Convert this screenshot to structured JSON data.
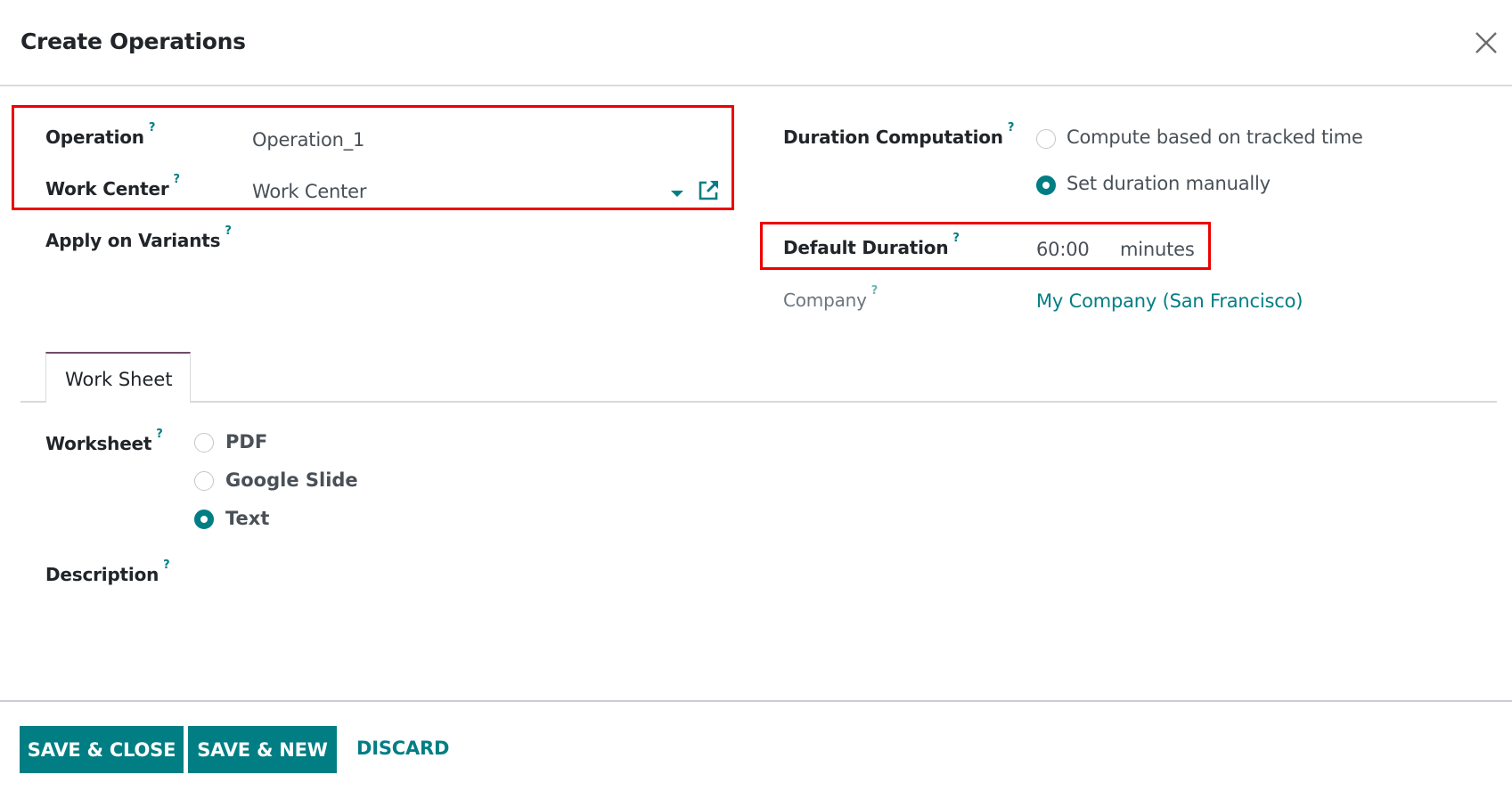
{
  "dialog": {
    "title": "Create Operations",
    "close_icon": "close-icon"
  },
  "fields": {
    "operation": {
      "label": "Operation",
      "help": "?",
      "value": "Operation_1"
    },
    "work_center": {
      "label": "Work Center",
      "help": "?",
      "value": "Work Center",
      "dropdown_icon": "caret-down-icon",
      "external_link_icon": "external-link-icon"
    },
    "apply_on_variants": {
      "label": "Apply on Variants",
      "help": "?",
      "value": ""
    },
    "duration_computation": {
      "label": "Duration Computation",
      "help": "?",
      "options": [
        {
          "label": "Compute based on tracked time",
          "checked": false
        },
        {
          "label": "Set duration manually",
          "checked": true
        }
      ]
    },
    "default_duration": {
      "label": "Default Duration",
      "help": "?",
      "value": "60:00",
      "unit": "minutes"
    },
    "company": {
      "label": "Company",
      "help": "?",
      "value": "My Company (San Francisco)"
    }
  },
  "tabs": [
    {
      "label": "Work Sheet",
      "active": true
    }
  ],
  "worksheet": {
    "label": "Worksheet",
    "help": "?",
    "options": [
      {
        "label": "PDF",
        "checked": false
      },
      {
        "label": "Google Slide",
        "checked": false
      },
      {
        "label": "Text",
        "checked": true
      }
    ]
  },
  "description": {
    "label": "Description",
    "help": "?",
    "value": ""
  },
  "footer": {
    "save_close_label": "SAVE & CLOSE",
    "save_new_label": "SAVE & NEW",
    "discard_label": "DISCARD"
  },
  "colors": {
    "accent": "#017e84",
    "tab_accent": "#714b67",
    "highlight_box": "#ee0000"
  }
}
